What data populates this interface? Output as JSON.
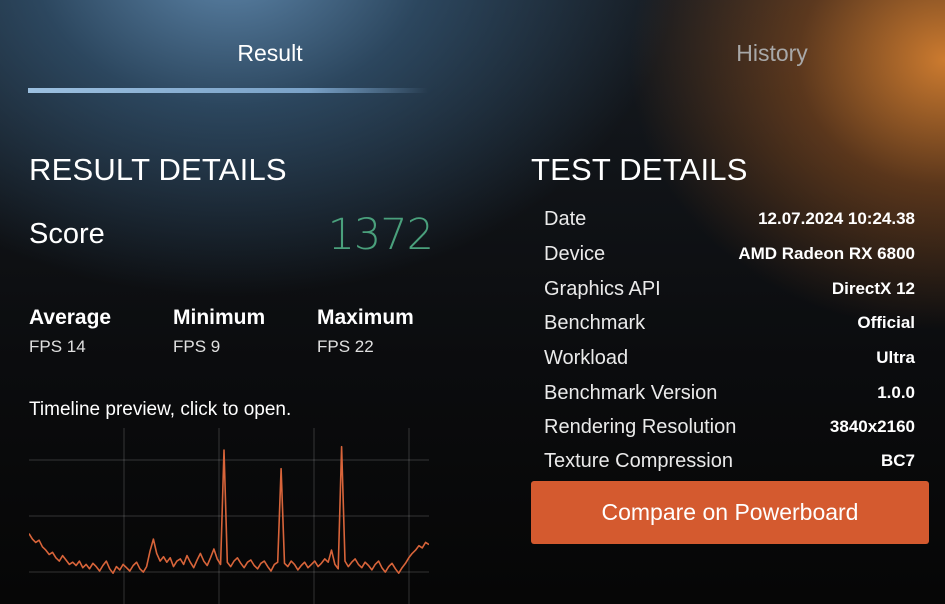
{
  "tabs": {
    "result": "Result",
    "history": "History"
  },
  "result_details": {
    "title": "RESULT DETAILS",
    "score_label": "Score",
    "score_value": "1372",
    "stats": [
      {
        "name": "Average",
        "value": "FPS 14"
      },
      {
        "name": "Minimum",
        "value": "FPS 9"
      },
      {
        "name": "Maximum",
        "value": "FPS 22"
      }
    ],
    "timeline_label": "Timeline preview, click to open."
  },
  "test_details": {
    "title": "TEST DETAILS",
    "rows": [
      {
        "key": "Date",
        "value": "12.07.2024 10:24.38"
      },
      {
        "key": "Device",
        "value": "AMD Radeon RX 6800"
      },
      {
        "key": "Graphics API",
        "value": "DirectX 12"
      },
      {
        "key": "Benchmark",
        "value": "Official"
      },
      {
        "key": "Workload",
        "value": "Ultra"
      },
      {
        "key": "Benchmark Version",
        "value": "1.0.0"
      },
      {
        "key": "Rendering Resolution",
        "value": "3840x2160"
      },
      {
        "key": "Texture Compression",
        "value": "BC7"
      }
    ],
    "compare_button": "Compare on Powerboard"
  },
  "colors": {
    "accent_orange": "#d45a2f",
    "score_green": "#4aa07c",
    "timeline_line": "#d8643a"
  },
  "timeline_preview": {
    "samples": [
      14.4,
      13.9,
      13.6,
      13.8,
      13.2,
      12.9,
      12.5,
      12.7,
      12.2,
      11.9,
      12.4,
      12.0,
      11.6,
      11.8,
      11.5,
      11.9,
      11.3,
      11.6,
      11.2,
      11.7,
      11.4,
      11.0,
      11.5,
      11.9,
      11.2,
      10.8,
      11.4,
      11.1,
      11.6,
      11.3,
      11.0,
      11.5,
      11.8,
      11.2,
      10.9,
      11.4,
      12.8,
      13.9,
      12.6,
      11.9,
      12.3,
      11.8,
      12.2,
      11.4,
      11.9,
      12.1,
      11.6,
      12.4,
      11.8,
      11.3,
      12.0,
      12.6,
      11.9,
      11.5,
      12.2,
      13.0,
      12.1,
      11.6,
      22.0,
      11.8,
      11.4,
      11.9,
      12.2,
      11.7,
      11.3,
      11.8,
      12.0,
      11.5,
      11.2,
      11.7,
      11.9,
      11.4,
      11.0,
      11.6,
      11.8,
      20.3,
      11.7,
      11.4,
      11.9,
      11.6,
      11.1,
      11.5,
      11.8,
      11.3,
      11.6,
      11.9,
      11.4,
      11.7,
      12.1,
      11.8,
      12.9,
      11.6,
      11.2,
      22.3,
      11.9,
      11.4,
      11.8,
      12.1,
      11.6,
      11.3,
      11.8,
      11.5,
      11.1,
      11.6,
      11.9,
      11.3,
      10.9,
      11.4,
      11.7,
      11.2,
      10.8,
      11.3,
      11.7,
      12.2,
      12.6,
      12.9,
      13.3,
      13.1,
      13.6,
      13.4
    ]
  }
}
